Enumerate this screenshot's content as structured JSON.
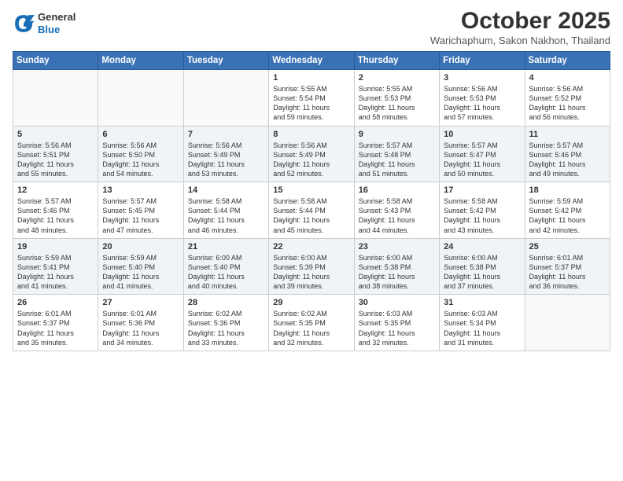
{
  "header": {
    "logo": {
      "line1": "General",
      "line2": "Blue"
    },
    "title": "October 2025",
    "subtitle": "Warichaphum, Sakon Nakhon, Thailand"
  },
  "weekdays": [
    "Sunday",
    "Monday",
    "Tuesday",
    "Wednesday",
    "Thursday",
    "Friday",
    "Saturday"
  ],
  "weeks": [
    [
      {
        "day": "",
        "info": ""
      },
      {
        "day": "",
        "info": ""
      },
      {
        "day": "",
        "info": ""
      },
      {
        "day": "1",
        "info": "Sunrise: 5:55 AM\nSunset: 5:54 PM\nDaylight: 11 hours\nand 59 minutes."
      },
      {
        "day": "2",
        "info": "Sunrise: 5:55 AM\nSunset: 5:53 PM\nDaylight: 11 hours\nand 58 minutes."
      },
      {
        "day": "3",
        "info": "Sunrise: 5:56 AM\nSunset: 5:53 PM\nDaylight: 11 hours\nand 57 minutes."
      },
      {
        "day": "4",
        "info": "Sunrise: 5:56 AM\nSunset: 5:52 PM\nDaylight: 11 hours\nand 56 minutes."
      }
    ],
    [
      {
        "day": "5",
        "info": "Sunrise: 5:56 AM\nSunset: 5:51 PM\nDaylight: 11 hours\nand 55 minutes."
      },
      {
        "day": "6",
        "info": "Sunrise: 5:56 AM\nSunset: 5:50 PM\nDaylight: 11 hours\nand 54 minutes."
      },
      {
        "day": "7",
        "info": "Sunrise: 5:56 AM\nSunset: 5:49 PM\nDaylight: 11 hours\nand 53 minutes."
      },
      {
        "day": "8",
        "info": "Sunrise: 5:56 AM\nSunset: 5:49 PM\nDaylight: 11 hours\nand 52 minutes."
      },
      {
        "day": "9",
        "info": "Sunrise: 5:57 AM\nSunset: 5:48 PM\nDaylight: 11 hours\nand 51 minutes."
      },
      {
        "day": "10",
        "info": "Sunrise: 5:57 AM\nSunset: 5:47 PM\nDaylight: 11 hours\nand 50 minutes."
      },
      {
        "day": "11",
        "info": "Sunrise: 5:57 AM\nSunset: 5:46 PM\nDaylight: 11 hours\nand 49 minutes."
      }
    ],
    [
      {
        "day": "12",
        "info": "Sunrise: 5:57 AM\nSunset: 5:46 PM\nDaylight: 11 hours\nand 48 minutes."
      },
      {
        "day": "13",
        "info": "Sunrise: 5:57 AM\nSunset: 5:45 PM\nDaylight: 11 hours\nand 47 minutes."
      },
      {
        "day": "14",
        "info": "Sunrise: 5:58 AM\nSunset: 5:44 PM\nDaylight: 11 hours\nand 46 minutes."
      },
      {
        "day": "15",
        "info": "Sunrise: 5:58 AM\nSunset: 5:44 PM\nDaylight: 11 hours\nand 45 minutes."
      },
      {
        "day": "16",
        "info": "Sunrise: 5:58 AM\nSunset: 5:43 PM\nDaylight: 11 hours\nand 44 minutes."
      },
      {
        "day": "17",
        "info": "Sunrise: 5:58 AM\nSunset: 5:42 PM\nDaylight: 11 hours\nand 43 minutes."
      },
      {
        "day": "18",
        "info": "Sunrise: 5:59 AM\nSunset: 5:42 PM\nDaylight: 11 hours\nand 42 minutes."
      }
    ],
    [
      {
        "day": "19",
        "info": "Sunrise: 5:59 AM\nSunset: 5:41 PM\nDaylight: 11 hours\nand 41 minutes."
      },
      {
        "day": "20",
        "info": "Sunrise: 5:59 AM\nSunset: 5:40 PM\nDaylight: 11 hours\nand 41 minutes."
      },
      {
        "day": "21",
        "info": "Sunrise: 6:00 AM\nSunset: 5:40 PM\nDaylight: 11 hours\nand 40 minutes."
      },
      {
        "day": "22",
        "info": "Sunrise: 6:00 AM\nSunset: 5:39 PM\nDaylight: 11 hours\nand 39 minutes."
      },
      {
        "day": "23",
        "info": "Sunrise: 6:00 AM\nSunset: 5:38 PM\nDaylight: 11 hours\nand 38 minutes."
      },
      {
        "day": "24",
        "info": "Sunrise: 6:00 AM\nSunset: 5:38 PM\nDaylight: 11 hours\nand 37 minutes."
      },
      {
        "day": "25",
        "info": "Sunrise: 6:01 AM\nSunset: 5:37 PM\nDaylight: 11 hours\nand 36 minutes."
      }
    ],
    [
      {
        "day": "26",
        "info": "Sunrise: 6:01 AM\nSunset: 5:37 PM\nDaylight: 11 hours\nand 35 minutes."
      },
      {
        "day": "27",
        "info": "Sunrise: 6:01 AM\nSunset: 5:36 PM\nDaylight: 11 hours\nand 34 minutes."
      },
      {
        "day": "28",
        "info": "Sunrise: 6:02 AM\nSunset: 5:36 PM\nDaylight: 11 hours\nand 33 minutes."
      },
      {
        "day": "29",
        "info": "Sunrise: 6:02 AM\nSunset: 5:35 PM\nDaylight: 11 hours\nand 32 minutes."
      },
      {
        "day": "30",
        "info": "Sunrise: 6:03 AM\nSunset: 5:35 PM\nDaylight: 11 hours\nand 32 minutes."
      },
      {
        "day": "31",
        "info": "Sunrise: 6:03 AM\nSunset: 5:34 PM\nDaylight: 11 hours\nand 31 minutes."
      },
      {
        "day": "",
        "info": ""
      }
    ]
  ]
}
